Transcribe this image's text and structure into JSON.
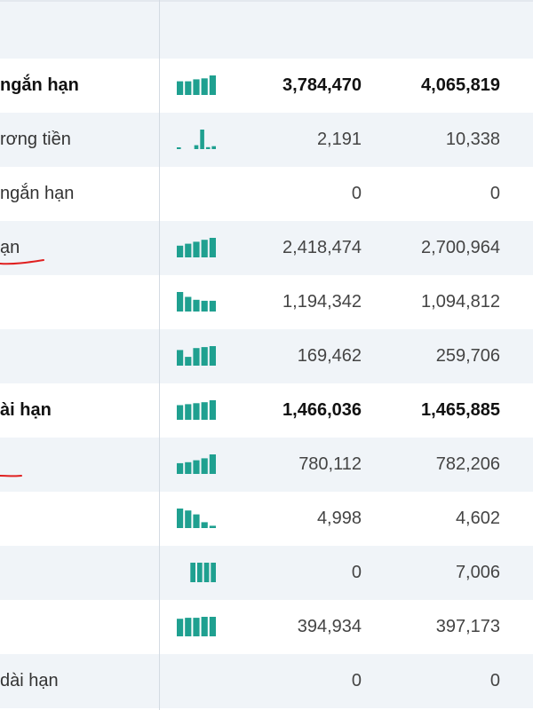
{
  "colors": {
    "spark": "#1fa090",
    "alt_row": "#f0f4f8",
    "divider": "#d4dbe3",
    "annotation": "#e02020"
  },
  "rows": [
    {
      "label": "ngắn hạn",
      "bold": true,
      "spark": [
        0.7,
        0.7,
        0.8,
        0.85,
        1.0
      ],
      "v1": "3,784,470",
      "v2": "4,065,819"
    },
    {
      "label": "rơng tiền",
      "bold": false,
      "spark": [
        0.08,
        0,
        0,
        0.2,
        1.0,
        0.1,
        0.15
      ],
      "v1": "2,191",
      "v2": "10,338"
    },
    {
      "label": "ngắn hạn",
      "bold": false,
      "spark": [],
      "v1": "0",
      "v2": "0"
    },
    {
      "label": "ạn",
      "bold": false,
      "spark": [
        0.6,
        0.7,
        0.8,
        0.9,
        1.0
      ],
      "v1": "2,418,474",
      "v2": "2,700,964"
    },
    {
      "label": "",
      "bold": false,
      "spark": [
        1.0,
        0.75,
        0.6,
        0.55,
        0.55
      ],
      "v1": "1,194,342",
      "v2": "1,094,812"
    },
    {
      "label": "",
      "bold": false,
      "spark": [
        0.8,
        0.45,
        0.9,
        0.95,
        1.0
      ],
      "v1": "169,462",
      "v2": "259,706"
    },
    {
      "label": "ài hạn",
      "bold": true,
      "spark": [
        0.75,
        0.8,
        0.85,
        0.9,
        1.0
      ],
      "v1": "1,466,036",
      "v2": "1,465,885"
    },
    {
      "label": "",
      "bold": false,
      "spark": [
        0.55,
        0.6,
        0.7,
        0.8,
        1.0
      ],
      "v1": "780,112",
      "v2": "782,206"
    },
    {
      "label": "",
      "bold": false,
      "spark": [
        1.0,
        0.9,
        0.7,
        0.3,
        0.12
      ],
      "v1": "4,998",
      "v2": "4,602"
    },
    {
      "label": "",
      "bold": false,
      "spark": [
        0,
        0,
        1.0,
        1.0,
        1.0,
        1.0
      ],
      "v1": "0",
      "v2": "7,006"
    },
    {
      "label": "",
      "bold": false,
      "spark": [
        0.9,
        0.95,
        0.95,
        1.0,
        1.0
      ],
      "v1": "394,934",
      "v2": "397,173"
    },
    {
      "label": "dài hạn",
      "bold": false,
      "spark": [],
      "v1": "0",
      "v2": "0"
    }
  ]
}
